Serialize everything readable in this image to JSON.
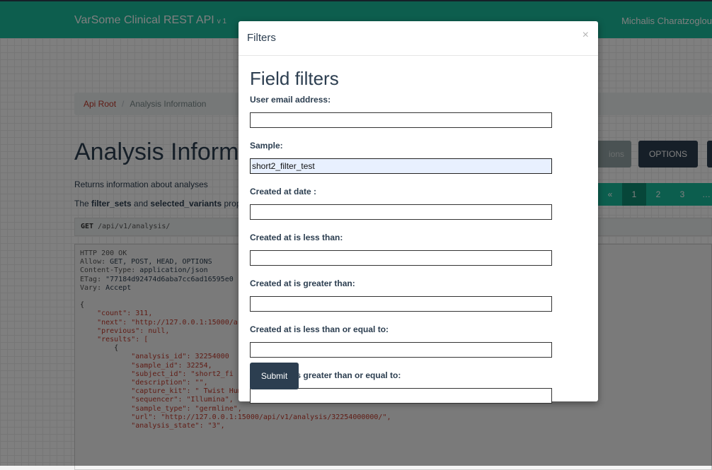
{
  "navbar": {
    "brand": "VarSome Clinical REST API",
    "version": "v 1",
    "user": "Michalis Charatzoglou"
  },
  "breadcrumb": {
    "root": "Api Root",
    "separator": "/",
    "current": "Analysis Information"
  },
  "page": {
    "title": "Analysis Information",
    "description": "Returns information about analyses",
    "note_prefix": "The ",
    "note_bold1": "filter_sets",
    "note_mid": " and ",
    "note_bold2": "selected_variants",
    "note_suffix": " prop",
    "request_method": "GET",
    "request_path": " /api/v1/analysis/",
    "filter_button": "ions",
    "options_button": "OPTIONS",
    "pager": [
      "«",
      "1",
      "2",
      "3",
      "…"
    ]
  },
  "response": {
    "line1": "HTTP 200 OK",
    "allow_key": "Allow:",
    "allow_val": " GET, POST, HEAD, OPTIONS",
    "ct_key": "Content-Type:",
    "ct_val": " application/json",
    "etag_key": "ETag:",
    "etag_val": " \"77184d92474d6aba7cc6ad16595e0",
    "vary_key": "Vary:",
    "vary_val": " Accept",
    "body_lines": [
      "{",
      "    \"count\": 311,",
      "    \"next\": \"http://127.0.0.1:15000/a",
      "    \"previous\": null,",
      "    \"results\": [",
      "        {",
      "            \"analysis_id\": 32254000",
      "            \"sample_id\": 32254,",
      "            \"subject_id\": \"short2_fi",
      "            \"description\": \"\",",
      "            \"capture_kit\": \" Twist Human Core Exome\",",
      "            \"sequencer\": \"Illumina\",",
      "            \"sample_type\": \"germline\",",
      "            \"url\": \"http://127.0.0.1:15000/api/v1/analysis/32254000000/\",",
      "            \"analysis_state\": \"3\","
    ]
  },
  "modal": {
    "title": "Filters",
    "close": "×",
    "heading": "Field filters",
    "fields": [
      {
        "label": "User email address:",
        "value": ""
      },
      {
        "label": "Sample:",
        "value": "short2_filter_test"
      },
      {
        "label": "Created at date :",
        "value": ""
      },
      {
        "label": "Created at is less than:",
        "value": ""
      },
      {
        "label": "Created at is greater than:",
        "value": ""
      },
      {
        "label": "Created at is less than or equal to:",
        "value": ""
      },
      {
        "label": "Created at is greater than or equal to:",
        "value": ""
      }
    ],
    "submit": "Submit"
  }
}
